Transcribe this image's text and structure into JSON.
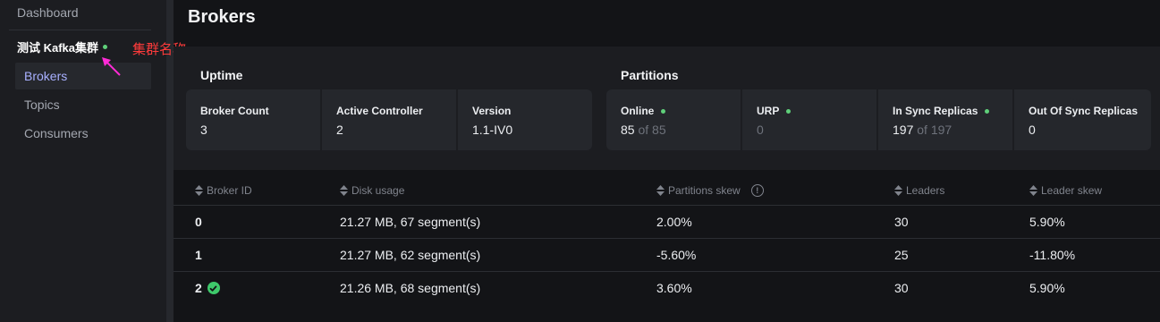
{
  "sidebar": {
    "dashboard_label": "Dashboard",
    "cluster_name": "测试 Kafka集群",
    "cluster_status_color": "#5fd07a",
    "annotation_text": "集群名称",
    "annotation_color": "#ff3b3b",
    "items": [
      {
        "label": "Brokers",
        "active": true
      },
      {
        "label": "Topics",
        "active": false
      },
      {
        "label": "Consumers",
        "active": false
      }
    ],
    "active_color": "#a8b0ff"
  },
  "page": {
    "title": "Brokers"
  },
  "uptime": {
    "title": "Uptime",
    "cards": [
      {
        "label": "Broker Count",
        "value": "3"
      },
      {
        "label": "Active Controller",
        "value": "2"
      },
      {
        "label": "Version",
        "value": "1.1-IV0"
      }
    ]
  },
  "partitions": {
    "title": "Partitions",
    "cards": [
      {
        "label": "Online",
        "value": "85",
        "suffix": "of 85",
        "dot": true
      },
      {
        "label": "URP",
        "value": "0",
        "dot": true
      },
      {
        "label": "In Sync Replicas",
        "value": "197",
        "suffix": "of 197",
        "dot": true
      },
      {
        "label": "Out Of Sync Replicas",
        "value": "0",
        "dot": false
      }
    ]
  },
  "table": {
    "columns": [
      "Broker ID",
      "Disk usage",
      "Partitions skew",
      "Leaders",
      "Leader skew"
    ],
    "rows": [
      {
        "broker_id": "0",
        "disk_usage": "21.27 MB, 67 segment(s)",
        "partitions_skew": "2.00%",
        "leaders": "30",
        "leader_skew": "5.90%",
        "controller": false
      },
      {
        "broker_id": "1",
        "disk_usage": "21.27 MB, 62 segment(s)",
        "partitions_skew": "-5.60%",
        "leaders": "25",
        "leader_skew": "-11.80%",
        "controller": false
      },
      {
        "broker_id": "2",
        "disk_usage": "21.26 MB, 68 segment(s)",
        "partitions_skew": "3.60%",
        "leaders": "30",
        "leader_skew": "5.90%",
        "controller": true
      }
    ]
  },
  "icons": {
    "sort": "sort-icon",
    "info": "info-icon",
    "controller": "check-circle-icon",
    "status": "status-dot-icon"
  },
  "colors": {
    "status_green": "#3ec96b",
    "background": "#131417",
    "panel": "#1c1d21",
    "card": "#25272c"
  }
}
